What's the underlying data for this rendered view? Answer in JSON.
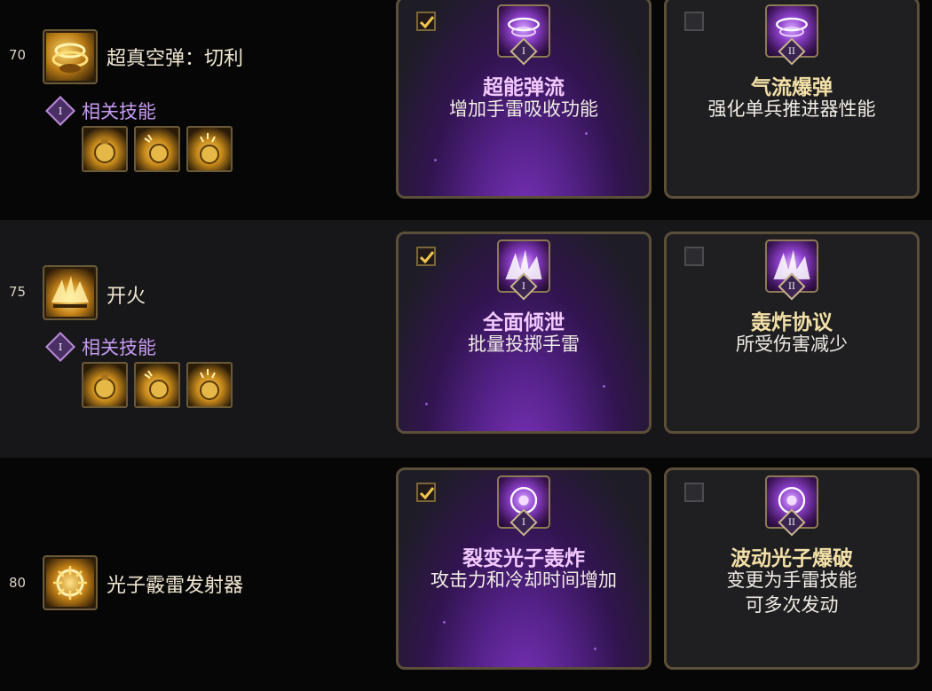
{
  "rows": [
    {
      "level": "70",
      "skill_name": "超真空弹：切利",
      "related_badge": "I",
      "related_label": "相关技能",
      "options": [
        {
          "roman": "I",
          "title": "超能弹流",
          "desc": [
            "增加手雷吸收功能"
          ],
          "selected": true
        },
        {
          "roman": "II",
          "title": "气流爆弹",
          "desc": [
            "强化单兵推进器性能"
          ],
          "selected": false
        }
      ]
    },
    {
      "level": "75",
      "skill_name": "开火",
      "related_badge": "I",
      "related_label": "相关技能",
      "options": [
        {
          "roman": "I",
          "title": "全面倾泄",
          "desc": [
            "批量投掷手雷"
          ],
          "selected": true
        },
        {
          "roman": "II",
          "title": "轰炸协议",
          "desc": [
            "所受伤害减少"
          ],
          "selected": false
        }
      ]
    },
    {
      "level": "80",
      "skill_name": "光子霰雷发射器",
      "options": [
        {
          "roman": "I",
          "title": "裂变光子轰炸",
          "desc": [
            "攻击力和冷却时间增加"
          ],
          "selected": true
        },
        {
          "roman": "II",
          "title": "波动光子爆破",
          "desc": [
            "变更为手雷技能",
            "可多次发动"
          ],
          "selected": false
        }
      ]
    }
  ],
  "colors": {
    "selected_glow": "#7a31b8",
    "gold_border": "#5c4f3a",
    "purple_label": "#c69bf2"
  },
  "icons": [
    "vacuum-bomb-icon",
    "fire-icon",
    "photon-launcher-icon",
    "grenade-icon",
    "checkbox-checked-icon",
    "checkbox-empty-icon"
  ]
}
